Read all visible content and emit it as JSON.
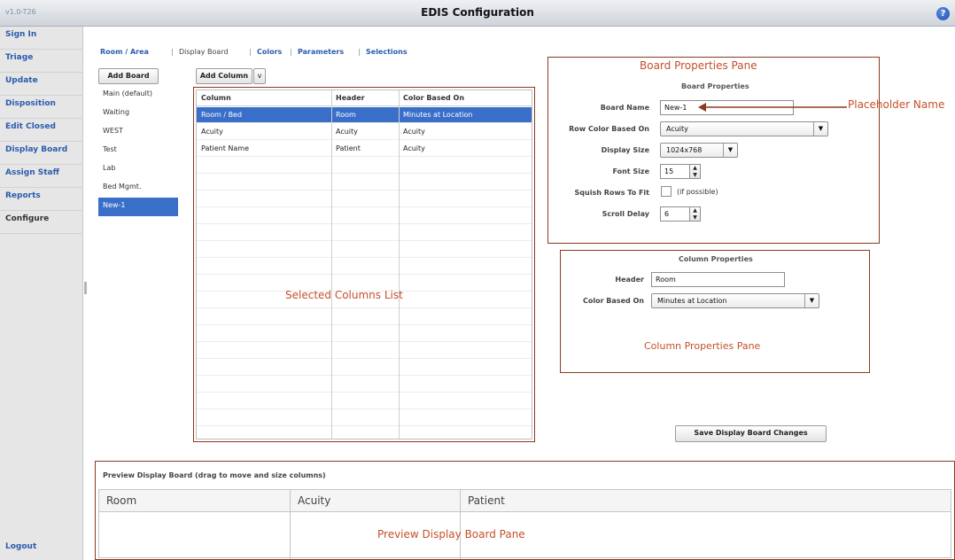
{
  "app": {
    "version": "v1.0-T26",
    "title": "EDIS Configuration",
    "help_glyph": "?"
  },
  "sidebar": {
    "items": [
      {
        "label": "Sign In"
      },
      {
        "label": "Triage"
      },
      {
        "label": "Update"
      },
      {
        "label": "Disposition"
      },
      {
        "label": "Edit Closed"
      },
      {
        "label": "Display Board"
      },
      {
        "label": "Assign Staff"
      },
      {
        "label": "Reports"
      },
      {
        "label": "Configure"
      }
    ],
    "logout": "Logout"
  },
  "tabs": [
    {
      "label": "Room / Area",
      "active": false
    },
    {
      "label": "Display Board",
      "active": true
    },
    {
      "label": "Colors",
      "active": false
    },
    {
      "label": "Parameters",
      "active": false
    },
    {
      "label": "Selections",
      "active": false
    }
  ],
  "toolbar": {
    "add_board": "Add Board",
    "add_column": "Add Column",
    "add_column_arrow": "v"
  },
  "boards": [
    {
      "label": "Main (default)",
      "selected": false
    },
    {
      "label": "Waiting",
      "selected": false
    },
    {
      "label": "WEST",
      "selected": false
    },
    {
      "label": "Test",
      "selected": false
    },
    {
      "label": "Lab",
      "selected": false
    },
    {
      "label": "Bed Mgmt.",
      "selected": false
    },
    {
      "label": "New-1",
      "selected": true
    }
  ],
  "columns_table": {
    "headers": [
      "Column",
      "Header",
      "Color Based On"
    ],
    "rows": [
      {
        "cells": [
          "Room / Bed",
          "Room",
          "Minutes at Location"
        ],
        "selected": true
      },
      {
        "cells": [
          "Acuity",
          "Acuity",
          "Acuity"
        ],
        "selected": false
      },
      {
        "cells": [
          "Patient Name",
          "Patient",
          "Acuity"
        ],
        "selected": false
      }
    ]
  },
  "annotations": {
    "board_pane": "Board Properties Pane",
    "placeholder": "Placeholder Name",
    "columns_list": "Selected Columns List",
    "column_pane": "Column Properties Pane",
    "preview_pane": "Preview Display Board Pane"
  },
  "board_properties": {
    "title": "Board Properties",
    "board_name_label": "Board Name",
    "board_name_value": "New-1",
    "row_color_label": "Row Color Based On",
    "row_color_value": "Acuity",
    "display_size_label": "Display Size",
    "display_size_value": "1024x768",
    "font_size_label": "Font Size",
    "font_size_value": "15",
    "squish_label": "Squish Rows To Fit",
    "squish_note": "(if possible)",
    "scroll_delay_label": "Scroll Delay",
    "scroll_delay_value": "6"
  },
  "column_properties": {
    "title": "Column Properties",
    "header_label": "Header",
    "header_value": "Room",
    "color_label": "Color Based On",
    "color_value": "Minutes at Location"
  },
  "save_button": "Save Display Board Changes",
  "preview": {
    "title": "Preview Display Board  (drag to move and size columns)",
    "columns": [
      "Room",
      "Acuity",
      "Patient"
    ]
  },
  "colors": {
    "selection": "#3a6fc9",
    "link": "#2b5cae",
    "annotation": "#c4502a",
    "annotation_border": "#8a3a1e"
  }
}
